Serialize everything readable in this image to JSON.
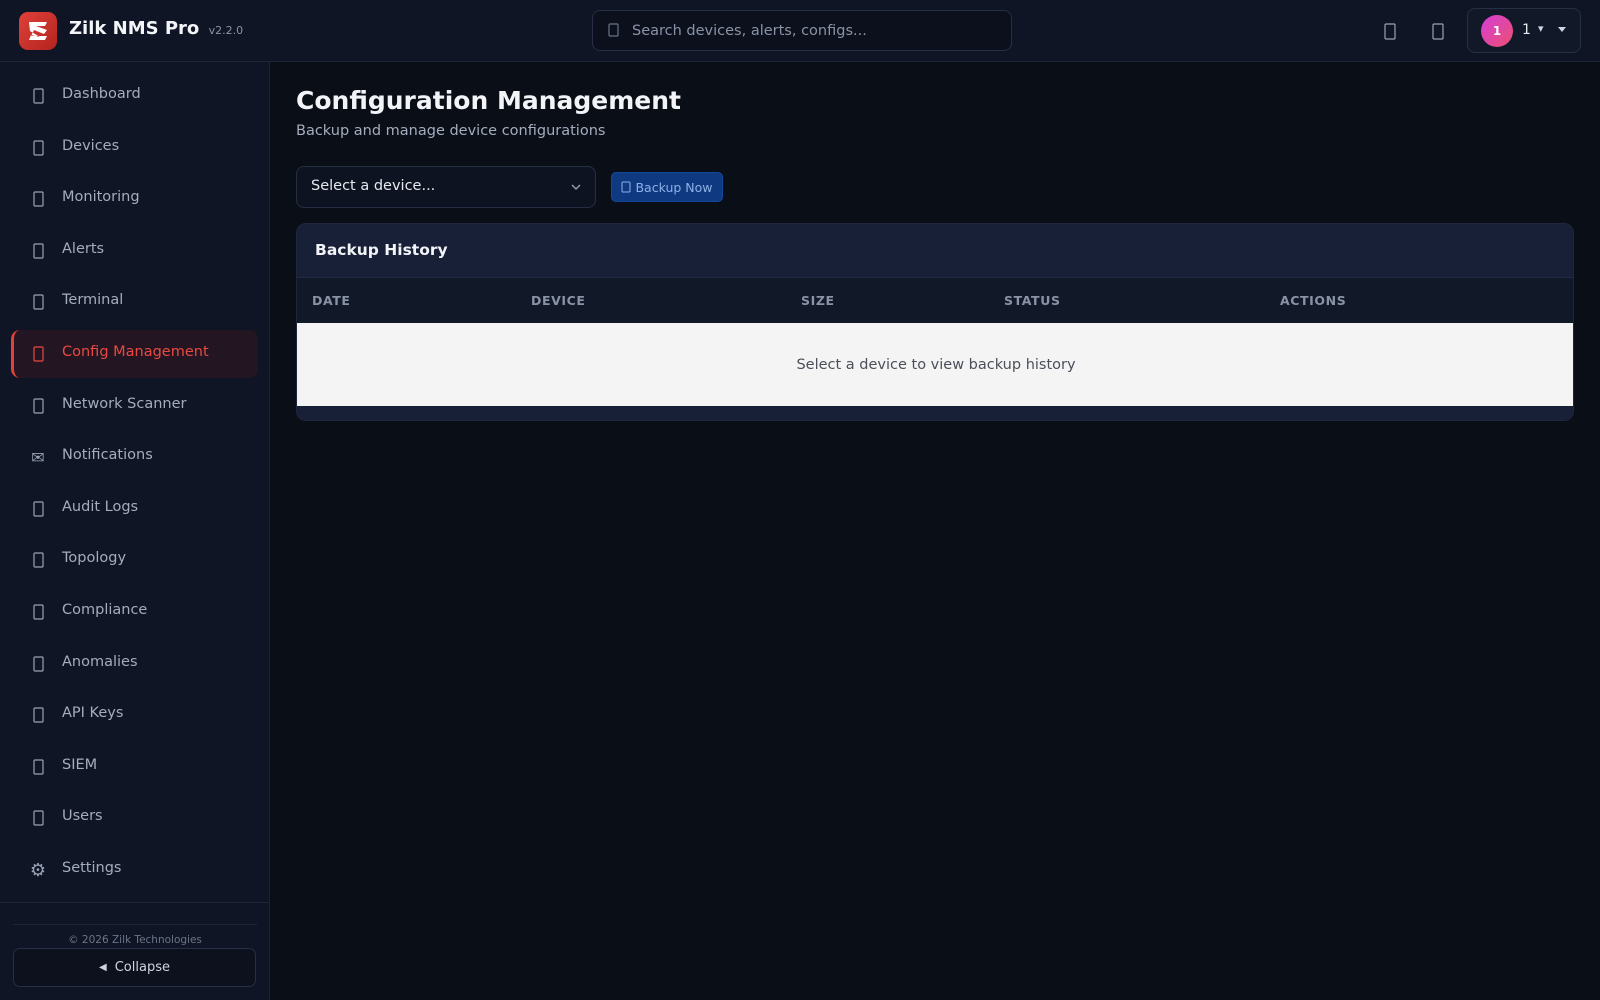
{
  "app": {
    "name": "Zilk NMS Pro",
    "version": "v2.2.0"
  },
  "search": {
    "placeholder": "Search devices, alerts, configs..."
  },
  "user": {
    "avatar_initial": "1",
    "name": "1",
    "caret": "▾"
  },
  "sidebar": {
    "items": [
      {
        "label": "Dashboard",
        "icon": "dashboard-icon"
      },
      {
        "label": "Devices",
        "icon": "devices-icon"
      },
      {
        "label": "Monitoring",
        "icon": "monitoring-icon"
      },
      {
        "label": "Alerts",
        "icon": "alerts-icon"
      },
      {
        "label": "Terminal",
        "icon": "terminal-icon"
      },
      {
        "label": "Config Management",
        "icon": "config-icon",
        "active": true
      },
      {
        "label": "Network Scanner",
        "icon": "scanner-icon"
      },
      {
        "label": "Notifications",
        "icon": "envelope-icon"
      },
      {
        "label": "Audit Logs",
        "icon": "audit-icon"
      },
      {
        "label": "Topology",
        "icon": "topology-icon"
      },
      {
        "label": "Compliance",
        "icon": "compliance-icon"
      },
      {
        "label": "Anomalies",
        "icon": "anomalies-icon"
      },
      {
        "label": "API Keys",
        "icon": "key-icon"
      },
      {
        "label": "SIEM",
        "icon": "siem-icon"
      },
      {
        "label": "Users",
        "icon": "users-icon"
      },
      {
        "label": "Settings",
        "icon": "gear-icon"
      }
    ],
    "copyright": "© 2026 Zilk Technologies",
    "collapse_arrow": "◀",
    "collapse_label": "Collapse"
  },
  "main": {
    "title": "Configuration Management",
    "subtitle": "Backup and manage device configurations",
    "device_select": {
      "selected": "Select a device..."
    },
    "backup_button": "Backup Now",
    "backup_history": {
      "title": "Backup History",
      "columns": [
        "DATE",
        "DEVICE",
        "SIZE",
        "STATUS",
        "ACTIONS"
      ],
      "empty_message": "Select a device to view backup history"
    }
  },
  "colors": {
    "accent": "#e0413a",
    "primary_button": "#0f3a82",
    "background": "#0a0e17",
    "panel": "#0f1524"
  }
}
